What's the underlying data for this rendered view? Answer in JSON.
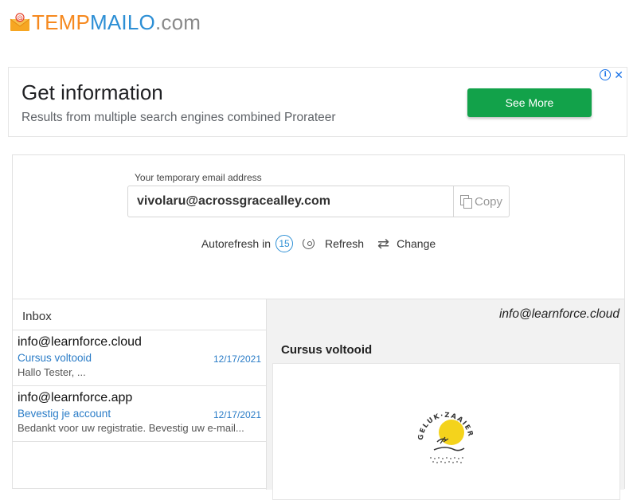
{
  "header": {
    "logo_temp": "TEMP",
    "logo_mailo": "MAILO",
    "logo_com": ".com",
    "logo_icon": "envelope-at-icon"
  },
  "ad": {
    "title": "Get information",
    "subtitle": "Results from multiple search engines combined Prorateer",
    "button_label": "See More",
    "info_glyph": "i",
    "close_glyph": "✕",
    "button_color": "#12a24a"
  },
  "address": {
    "caption": "Your temporary email address",
    "value": "vivolaru@acrossgracealley.com",
    "copy_label": "Copy"
  },
  "controls": {
    "autorefresh_label": "Autorefresh in",
    "countdown": "15",
    "refresh_label": "Refresh",
    "change_label": "Change"
  },
  "inbox": {
    "title": "Inbox",
    "messages": [
      {
        "from": "info@learnforce.cloud",
        "subject": "Cursus voltooid",
        "date": "12/17/2021",
        "preview": "Hallo Tester, ..."
      },
      {
        "from": "info@learnforce.app",
        "subject": "Bevestig je account",
        "date": "12/17/2021",
        "preview": "Bedankt voor uw registratie. Bevestig uw e-mail..."
      }
    ]
  },
  "reader": {
    "from": "info@learnforce.cloud",
    "subject": "Cursus voltooid",
    "logo_text": "GELUK·ZAAIERS"
  },
  "colors": {
    "accent_orange": "#f6891f",
    "accent_blue": "#2d8fd5",
    "link_blue": "#2a7cc7"
  }
}
